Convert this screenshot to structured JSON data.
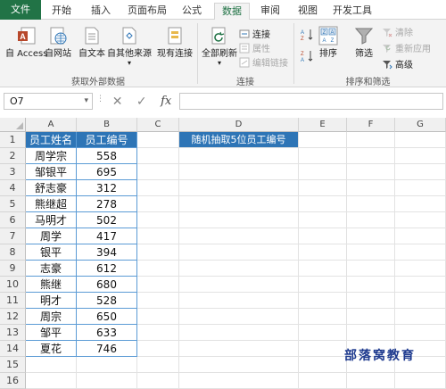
{
  "tabs": [
    "文件",
    "开始",
    "插入",
    "页面布局",
    "公式",
    "数据",
    "审阅",
    "视图",
    "开发工具"
  ],
  "ribbon": {
    "external": {
      "access": "自 Access",
      "web": "自网站",
      "text": "自文本",
      "other": "自其他来源",
      "existing": "现有连接",
      "group": "获取外部数据"
    },
    "connections": {
      "refresh_all": "全部刷新",
      "connections": "连接",
      "properties": "属性",
      "edit_links": "编辑链接",
      "group": "连接"
    },
    "sort": {
      "sort": "排序",
      "filter": "筛选",
      "clear": "清除",
      "reapply": "重新应用",
      "advanced": "高级",
      "group": "排序和筛选"
    }
  },
  "formula_bar": {
    "name_box": "O7",
    "fx": "fx",
    "cancel": "✕",
    "enter": "✓",
    "formula": ""
  },
  "columns": [
    "A",
    "B",
    "C",
    "D",
    "E",
    "F",
    "G"
  ],
  "rows": [
    "1",
    "2",
    "3",
    "4",
    "5",
    "6",
    "7",
    "8",
    "9",
    "10",
    "11",
    "12",
    "13",
    "14",
    "15",
    "16"
  ],
  "table": {
    "header_name": "员工姓名",
    "header_id": "员工编号",
    "names": [
      "周学宗",
      "邹银平",
      "舒志豪",
      "熊继超",
      "马明才",
      "周学",
      "银平",
      "志豪",
      "熊继",
      "明才",
      "周宗",
      "邹平",
      "夏花"
    ],
    "ids": [
      "558",
      "695",
      "312",
      "278",
      "502",
      "417",
      "394",
      "612",
      "680",
      "528",
      "650",
      "633",
      "746"
    ]
  },
  "d1_header": "随机抽取5位员工编号",
  "watermark": "部落窝教育",
  "colors": {
    "excel_green": "#217346",
    "table_header": "#2e75b6",
    "table_border": "#5b9bd5"
  }
}
